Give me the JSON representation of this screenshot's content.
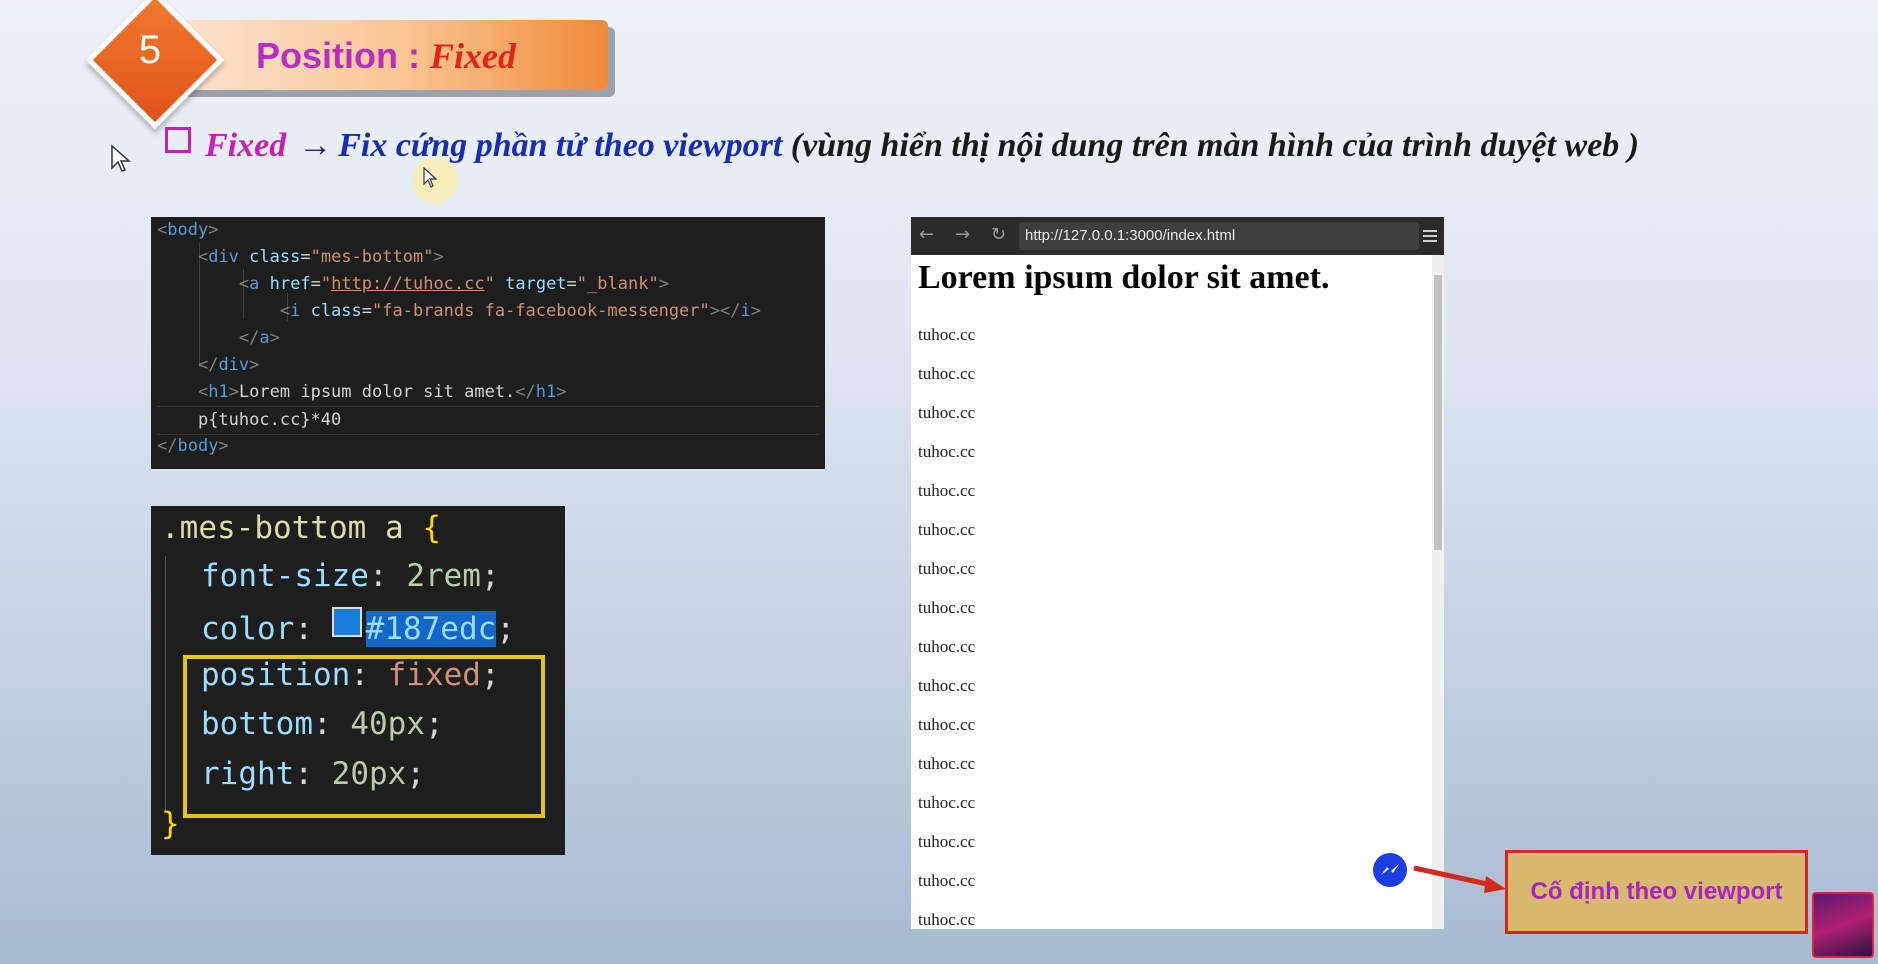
{
  "slide": {
    "number": "5",
    "title_prefix": "Position : ",
    "title_emphasis": "Fixed"
  },
  "heading": {
    "term": "Fixed",
    "arrow": "→",
    "definition": "Fix cứng phần tử theo viewport",
    "note": "(vùng hiển thị nội dung trên màn hình của trình duyệt web )"
  },
  "html_code": {
    "body_open": "body",
    "div_tag": "div",
    "class_attr": "class",
    "div_class": "\"mes-bottom\"",
    "a_tag": "a",
    "href_attr": "href",
    "href_value": "http://tuhoc.cc",
    "target_attr": "target",
    "target_value": "\"_blank\"",
    "i_tag": "i",
    "i_class": "\"fa-brands fa-facebook-messenger\"",
    "h1_tag": "h1",
    "h1_text": "Lorem ipsum dolor sit amet.",
    "emmet": "p{tuhoc.cc}*40"
  },
  "css_code": {
    "selector": ".mes-bottom a",
    "open": "{",
    "close": "}",
    "props": [
      {
        "name": "font-size",
        "value": "2rem"
      },
      {
        "name": "color",
        "value": "#187edc"
      },
      {
        "name": "position",
        "value": "fixed"
      },
      {
        "name": "bottom",
        "value": "40px"
      },
      {
        "name": "right",
        "value": "20px"
      }
    ],
    "swatch_color": "#187edc"
  },
  "browser": {
    "back_icon": "arrow-left",
    "forward_icon": "arrow-right",
    "reload_icon": "reload",
    "menu_icon": "hamburger-menu",
    "url": "http://127.0.0.1:3000/index.html",
    "h1": "Lorem ipsum dolor sit amet.",
    "paragraphs": [
      "tuhoc.cc",
      "tuhoc.cc",
      "tuhoc.cc",
      "tuhoc.cc",
      "tuhoc.cc",
      "tuhoc.cc",
      "tuhoc.cc",
      "tuhoc.cc",
      "tuhoc.cc",
      "tuhoc.cc",
      "tuhoc.cc",
      "tuhoc.cc",
      "tuhoc.cc",
      "tuhoc.cc",
      "tuhoc.cc",
      "tuhoc.cc"
    ],
    "fixed_icon": "facebook-messenger",
    "fixed_icon_color": "#1c3de0"
  },
  "callout": {
    "text": "Cố định theo viewport"
  },
  "colors": {
    "title_text": "#b92ec2",
    "title_emphasis": "#e0231c",
    "badge": "#e8632a",
    "callout_bg": "#d9b870",
    "callout_border": "#d12a1a",
    "highlight_box": "#e3c61d"
  }
}
